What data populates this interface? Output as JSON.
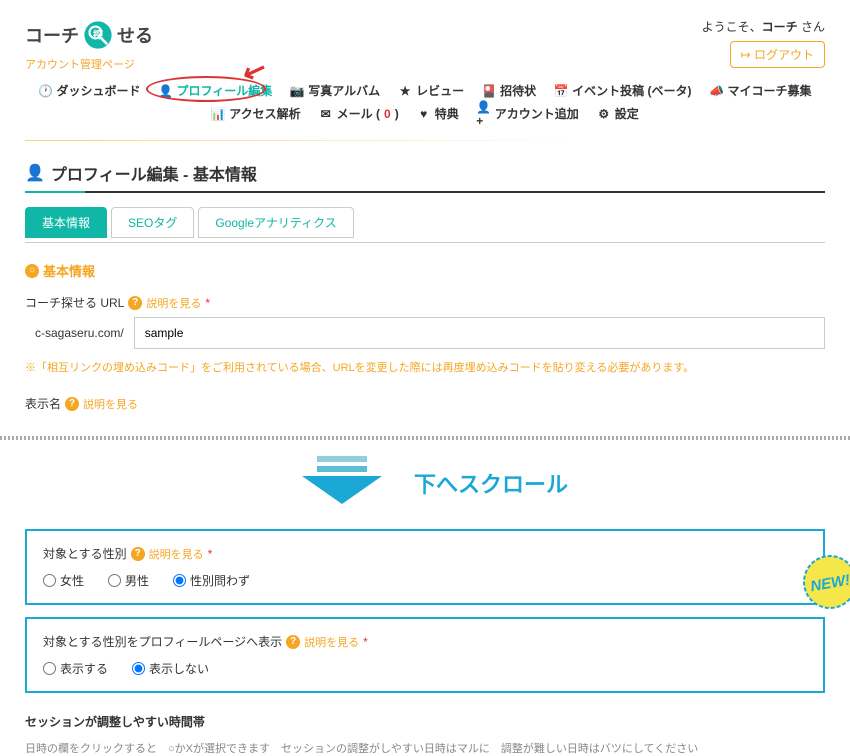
{
  "header": {
    "logo_left": "コーチ",
    "logo_right": "せる",
    "logo_sub": "アカウント管理ページ",
    "welcome_prefix": "ようこそ、",
    "welcome_name": "コーチ",
    "welcome_suffix": " さん",
    "logout": "ログアウト"
  },
  "nav": {
    "dashboard": "ダッシュボード",
    "profile_edit": "プロフィール編集",
    "photo_album": "写真アルバム",
    "review": "レビュー",
    "invitation": "招待状",
    "event_post": "イベント投稿 (ベータ)",
    "my_coach": "マイコーチ募集",
    "access": "アクセス解析",
    "mail": "メール (",
    "mail_count": "0",
    "mail_close": ")",
    "benefit": "特典",
    "add_account": "アカウント追加",
    "settings": "設定"
  },
  "page": {
    "title": "プロフィール編集 - 基本情報"
  },
  "tabs": {
    "basic": "基本情報",
    "seo": "SEOタグ",
    "ga": "Googleアナリティクス"
  },
  "section": {
    "basic_heading": "基本情報",
    "url_label": "コーチ探せる URL",
    "help_text": "説明を見る",
    "required_mark": "*",
    "url_prefix": "c-sagaseru.com/",
    "url_value": "sample",
    "url_note": "※「相互リンクの埋め込みコード」をご利用されている場合、URLを変更した際には再度埋め込みコードを貼り変える必要があります。",
    "display_name_label": "表示名"
  },
  "scroll": {
    "text": "下へスクロール"
  },
  "gender_box": {
    "label": "対象とする性別",
    "opt_female": "女性",
    "opt_male": "男性",
    "opt_any": "性別問わず"
  },
  "display_box": {
    "label": "対象とする性別をプロフィールページへ表示",
    "opt_show": "表示する",
    "opt_hide": "表示しない"
  },
  "session": {
    "label": "セッションが調整しやすい時間帯",
    "note": "日時の欄をクリックすると　○かXが選択できます　セッションの調整がしやすい日時はマルに　調整が難しい日時はバツにしてください"
  },
  "new_badge": "NEW!"
}
